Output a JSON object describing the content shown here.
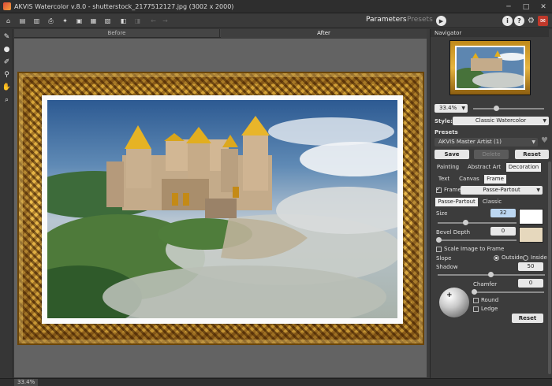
{
  "window": {
    "title": "AKVIS Watercolor v.8.0 - shutterstock_2177512127.jpg (3002 x 2000)",
    "minimize_glyph": "─",
    "maximize_glyph": "□",
    "close_glyph": "✕"
  },
  "toolbar": {
    "buttons": [
      "home-icon",
      "open-icon",
      "save-icon",
      "print-icon",
      "share-icon",
      "batch-icon",
      "settings-icon",
      "prefs-icon",
      "undo-icon",
      "redo-icon"
    ],
    "parameters_tab": "Parameters",
    "presets_tab": "Presets",
    "info_glyph": "i",
    "help_glyph": "?",
    "gear_glyph": "⚙",
    "feedback_glyph": "✉"
  },
  "tools": [
    "brush-icon",
    "drop-icon",
    "history-icon",
    "eyedropper-icon",
    "hand-icon",
    "zoom-icon"
  ],
  "view_tabs": {
    "before": "Before",
    "after": "After"
  },
  "status": {
    "zoom": "33.4%"
  },
  "panel": {
    "navigator_label": "Navigator",
    "zoom_value": "33.4%",
    "style_label": "Style:",
    "style_value": "Classic Watercolor",
    "presets_label": "Presets",
    "preset_value": "AKVIS Master Artist (1)",
    "save_button": "Save",
    "delete_button": "Delete",
    "reset_button": "Reset",
    "tabs": [
      "Painting",
      "Abstract Art",
      "Decoration"
    ],
    "sub_tabs": [
      "Text",
      "Canvas",
      "Frame"
    ],
    "frame_label": "Frame",
    "frame_type": "Passe-Partout",
    "frame_tabs": [
      "Passe-Partout",
      "Classic"
    ],
    "size_label": "Size",
    "size_value": "32",
    "bevel_label": "Bevel Depth",
    "bevel_value": "0",
    "scale_label": "Scale Image to Frame",
    "slope_label": "Slope",
    "outside_label": "Outside",
    "inside_label": "Inside",
    "shadow_label": "Shadow",
    "shadow_value": "50",
    "chamfer_label": "Chamfer",
    "chamfer_value": "0",
    "round_label": "Round",
    "ledge_label": "Ledge",
    "bottom_reset": "Reset"
  },
  "colors": {
    "swatch_white": "#ffffff",
    "swatch_beige": "#e6d8bd",
    "frame_gold": "#c8901e"
  }
}
